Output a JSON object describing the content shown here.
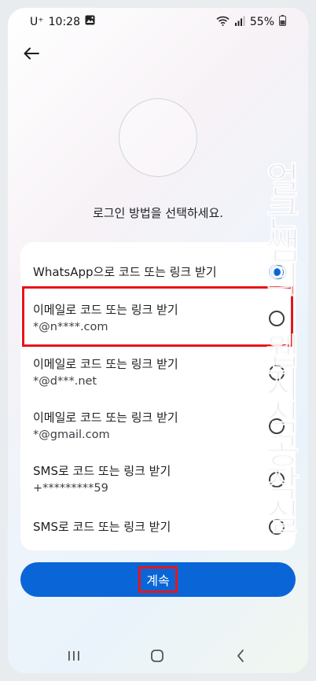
{
  "status_bar": {
    "carrier": "U⁺",
    "time": "10:28",
    "battery": "55%"
  },
  "page": {
    "prompt": "로그인 방법을 선택하세요.",
    "options": [
      {
        "label": "WhatsApp으로 코드 또는 링크 받기",
        "sub": "",
        "selected": true
      },
      {
        "label": "이메일로 코드 또는 링크 받기",
        "sub": "*@n****.com",
        "selected": false
      },
      {
        "label": "이메일로 코드 또는 링크 받기",
        "sub": "*@d***.net",
        "selected": false
      },
      {
        "label": "이메일로 코드 또는 링크 받기",
        "sub": "*@gmail.com",
        "selected": false
      },
      {
        "label": "SMS로 코드 또는 링크 받기",
        "sub": "+*********59",
        "selected": false
      },
      {
        "label": "SMS로 코드 또는 링크 받기",
        "sub": "",
        "selected": false
      }
    ],
    "continue_label": "계속"
  },
  "watermark": "얼큰쌤의 웹지식공작실",
  "colors": {
    "accent": "#0a66d6",
    "highlight": "#e8141b"
  },
  "icons": [
    "back-arrow-icon",
    "recent-apps-icon",
    "home-icon",
    "nav-back-icon",
    "wifi-icon",
    "signal-icon",
    "battery-icon",
    "gallery-icon"
  ]
}
